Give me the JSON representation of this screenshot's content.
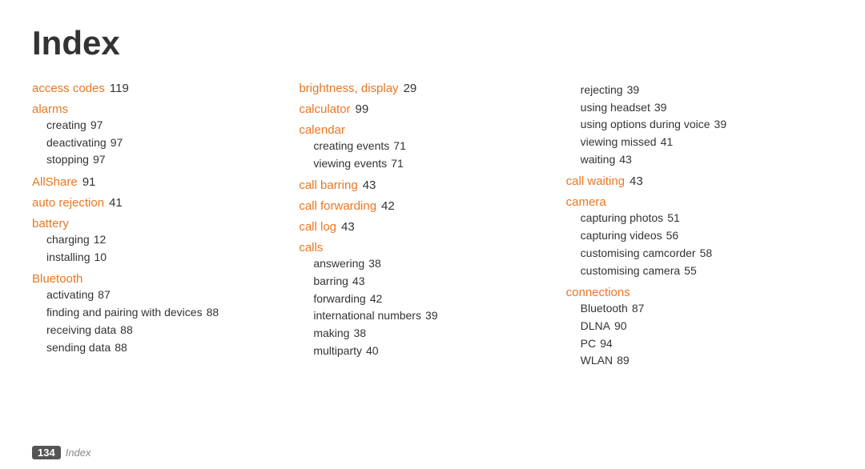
{
  "title": "Index",
  "footer": {
    "page_number": "134",
    "label": "Index"
  },
  "columns": [
    {
      "id": "col1",
      "entries": [
        {
          "term": "access codes",
          "num": "119",
          "subs": []
        },
        {
          "term": "alarms",
          "num": "",
          "subs": [
            {
              "text": "creating",
              "num": "97"
            },
            {
              "text": "deactivating",
              "num": "97"
            },
            {
              "text": "stopping",
              "num": "97"
            }
          ]
        },
        {
          "term": "AllShare",
          "num": "91",
          "subs": []
        },
        {
          "term": "auto rejection",
          "num": "41",
          "subs": []
        },
        {
          "term": "battery",
          "num": "",
          "subs": [
            {
              "text": "charging",
              "num": "12"
            },
            {
              "text": "installing",
              "num": "10"
            }
          ]
        },
        {
          "term": "Bluetooth",
          "num": "",
          "subs": [
            {
              "text": "activating",
              "num": "87"
            },
            {
              "text": "finding and pairing with devices",
              "num": "88"
            },
            {
              "text": "receiving data",
              "num": "88"
            },
            {
              "text": "sending data",
              "num": "88"
            }
          ]
        }
      ]
    },
    {
      "id": "col2",
      "entries": [
        {
          "term": "brightness, display",
          "num": "29",
          "subs": []
        },
        {
          "term": "calculator",
          "num": "99",
          "subs": []
        },
        {
          "term": "calendar",
          "num": "",
          "subs": [
            {
              "text": "creating events",
              "num": "71"
            },
            {
              "text": "viewing events",
              "num": "71"
            }
          ]
        },
        {
          "term": "call barring",
          "num": "43",
          "subs": []
        },
        {
          "term": "call forwarding",
          "num": "42",
          "subs": []
        },
        {
          "term": "call log",
          "num": "43",
          "subs": []
        },
        {
          "term": "calls",
          "num": "",
          "subs": [
            {
              "text": "answering",
              "num": "38"
            },
            {
              "text": "barring",
              "num": "43"
            },
            {
              "text": "forwarding",
              "num": "42"
            },
            {
              "text": "international numbers",
              "num": "39"
            },
            {
              "text": "making",
              "num": "38"
            },
            {
              "text": "multiparty",
              "num": "40"
            }
          ]
        }
      ]
    },
    {
      "id": "col3",
      "entries": [
        {
          "term": "",
          "num": "",
          "subs": [
            {
              "text": "rejecting",
              "num": "39"
            },
            {
              "text": "using headset",
              "num": "39"
            },
            {
              "text": "using options during voice",
              "num": "39"
            },
            {
              "text": "viewing missed",
              "num": "41"
            },
            {
              "text": "waiting",
              "num": "43"
            }
          ]
        },
        {
          "term": "call waiting",
          "num": "43",
          "subs": []
        },
        {
          "term": "camera",
          "num": "",
          "subs": [
            {
              "text": "capturing photos",
              "num": "51"
            },
            {
              "text": "capturing videos",
              "num": "56"
            },
            {
              "text": "customising camcorder",
              "num": "58"
            },
            {
              "text": "customising camera",
              "num": "55"
            }
          ]
        },
        {
          "term": "connections",
          "num": "",
          "subs": [
            {
              "text": "Bluetooth",
              "num": "87"
            },
            {
              "text": "DLNA",
              "num": "90"
            },
            {
              "text": "PC",
              "num": "94"
            },
            {
              "text": "WLAN",
              "num": "89"
            }
          ]
        }
      ]
    }
  ]
}
